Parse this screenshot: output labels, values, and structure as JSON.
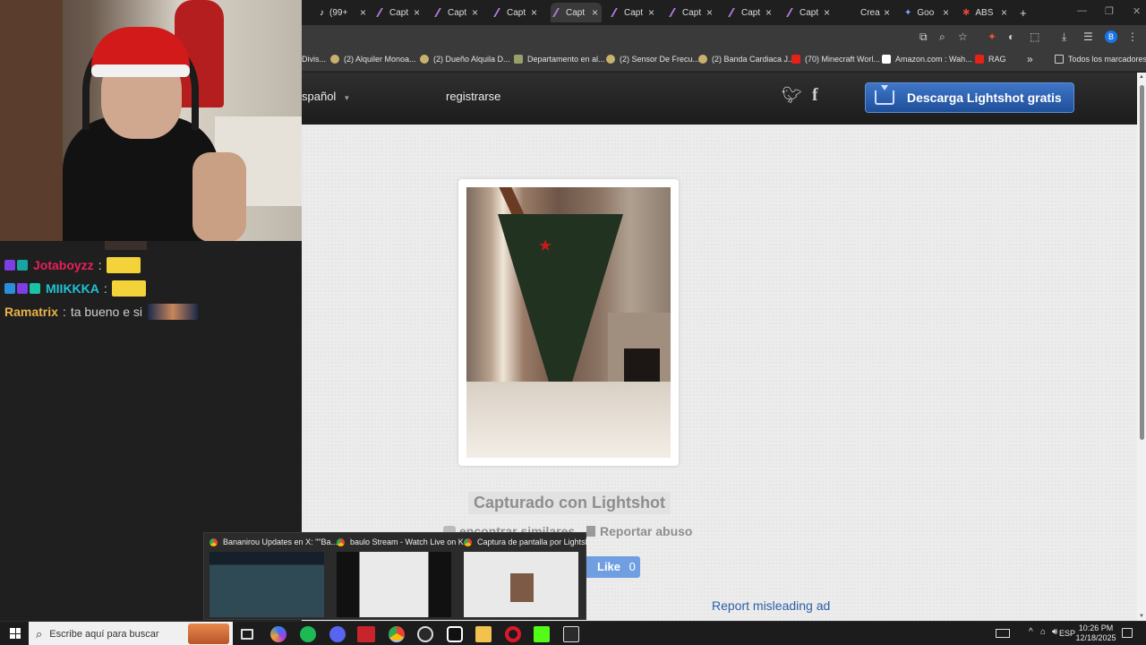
{
  "browser": {
    "tabs": [
      {
        "label": "(99+",
        "favicon": "tiktok-icon"
      },
      {
        "label": "Capt",
        "favicon": "lightshot-feather-icon"
      },
      {
        "label": "Capt",
        "favicon": "lightshot-feather-icon"
      },
      {
        "label": "Capt",
        "favicon": "lightshot-feather-icon"
      },
      {
        "label": "Capt",
        "favicon": "lightshot-feather-icon",
        "active": true
      },
      {
        "label": "Capt",
        "favicon": "lightshot-feather-icon"
      },
      {
        "label": "Capt",
        "favicon": "lightshot-feather-icon"
      },
      {
        "label": "Capt",
        "favicon": "lightshot-feather-icon"
      },
      {
        "label": "Capt",
        "favicon": "lightshot-feather-icon"
      },
      {
        "label": "Crea",
        "favicon": "none"
      },
      {
        "label": "Goo",
        "favicon": "gemini-icon"
      },
      {
        "label": "ABS",
        "favicon": "abs-icon"
      }
    ],
    "new_tab_symbol": "+",
    "bookmarks": [
      {
        "label": "Divis...",
        "icon": "none"
      },
      {
        "label": "(2) Alquiler Monoa...",
        "icon": "marketplace-icon"
      },
      {
        "label": "(2) Dueño Alquila D...",
        "icon": "marketplace-icon"
      },
      {
        "label": "Departamento en al...",
        "icon": "listing-icon"
      },
      {
        "label": "(2) Sensor De Frecu...",
        "icon": "marketplace-icon"
      },
      {
        "label": "(2) Banda Cardiaca J...",
        "icon": "marketplace-icon"
      },
      {
        "label": "(70) Minecraft Worl...",
        "icon": "youtube-icon"
      },
      {
        "label": "Amazon.com : Wah...",
        "icon": "amazon-icon"
      },
      {
        "label": "RAG",
        "icon": "youtube-icon"
      }
    ],
    "bookmarks_overflow": "»",
    "all_bookmarks": "Todos los marcadores",
    "profile_initial": "B"
  },
  "lightshot": {
    "language": "spañol",
    "register": "registrarse",
    "download_button": "Descarga Lightshot gratis",
    "caption": "Capturado con Lightshot",
    "find_similar": "encontrar similares",
    "report_abuse": "Reportar abuso",
    "like_label": "Like",
    "like_count": "0",
    "report_misleading_ad": "Report misleading ad"
  },
  "chat": {
    "lines": [
      {
        "user": "Jotaboyzz",
        "color": "#e8205a",
        "message": "",
        "sep": ":"
      },
      {
        "user": "MIIKKKA",
        "color": "#1fc3d6",
        "message": "",
        "sep": ":"
      },
      {
        "user": "Ramatrix",
        "color": "#e8b24a",
        "message": "ta bueno e si",
        "sep": ":"
      }
    ]
  },
  "taskbar_previews": [
    {
      "title": "Bananirou Updates en X: \"\"Ba..."
    },
    {
      "title": "baulo Stream - Watch Live on K..."
    },
    {
      "title": "Captura de pantalla por Lightsh..."
    }
  ],
  "taskbar": {
    "search_placeholder": "Escribe aquí para buscar",
    "language": "ESP",
    "time": "10:26 PM",
    "date": "12/18/2025"
  },
  "colors": {
    "lightshot_blue": "#2b5fa8",
    "download_button": "#3f76c8",
    "page_bg": "#ececec"
  }
}
